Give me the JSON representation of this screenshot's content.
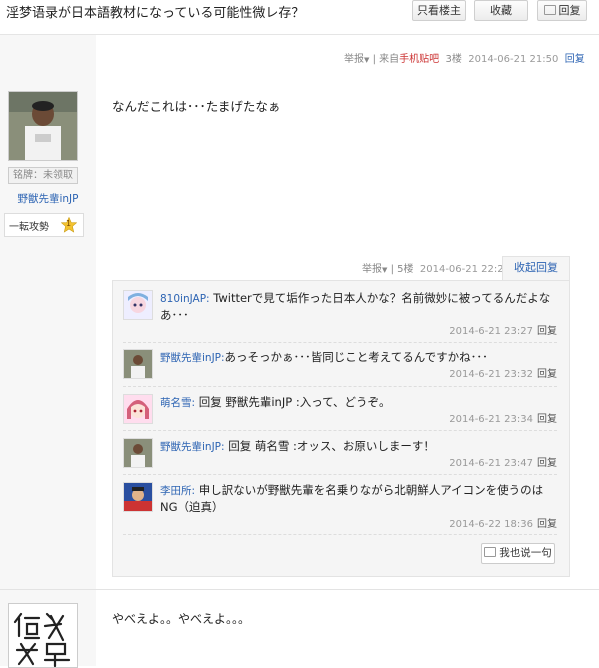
{
  "header": {
    "title": "淫梦语录が日本語教材になっている可能性微レ存？",
    "only_host_label": "只看楼主",
    "favorite_label": "收藏",
    "reply_label": "回复"
  },
  "post3": {
    "report_label": "举报",
    "source_prefix": "| 来自",
    "source_link": "手机贴吧",
    "floor": "3楼",
    "date": "2014-06-21 21:50",
    "reply_label": "回复",
    "user": {
      "badge_label": "铭牌：未领取",
      "name": "野獣先輩inJP",
      "level_title": "一転攻勢",
      "level_number": "1"
    },
    "content": "なんだこれは･･･たまげたなぁ"
  },
  "post5": {
    "report_label": "举报",
    "floor_separator": "|",
    "floor": "5楼",
    "date": "2014-06-21 22:22",
    "collapse_label": "收起回复",
    "comments": [
      {
        "user": "810inJAP:",
        "text": "Twitterで見て垢作った日本人かな？名前微妙に被ってるんだよなあ･･･",
        "date": "2014-6-21 23:27",
        "reply_label": "回复"
      },
      {
        "user": "野獣先輩inJP:",
        "text": "あっそっかぁ･･･皆同じこと考えてるんですかね･･･",
        "date": "2014-6-21 23:32",
        "reply_label": "回复"
      },
      {
        "user": "萌名雪:",
        "text": "回复 野獣先輩inJP :入って、どうぞ。",
        "date": "2014-6-21 23:34",
        "reply_label": "回复"
      },
      {
        "user": "野獣先輩inJP:",
        "text": "回复 萌名雪 :オッス、お原いしまーす！",
        "date": "2014-6-21 23:47",
        "reply_label": "回复"
      },
      {
        "user": "李田所:",
        "text": "申し訳ないが野獣先輩を名乗りながら北朝鮮人アイコンを使うのはNG（迫真）",
        "date": "2014-6-22 18:36",
        "reply_label": "回复"
      }
    ],
    "say_label": "我也说一句"
  },
  "post6": {
    "content": "やべえよ。。やべえよ。。。"
  },
  "colors": {
    "link": "#2d64b3",
    "sidebar_bg": "#f7f7f7",
    "comment_bg": "#f5f5f5"
  }
}
